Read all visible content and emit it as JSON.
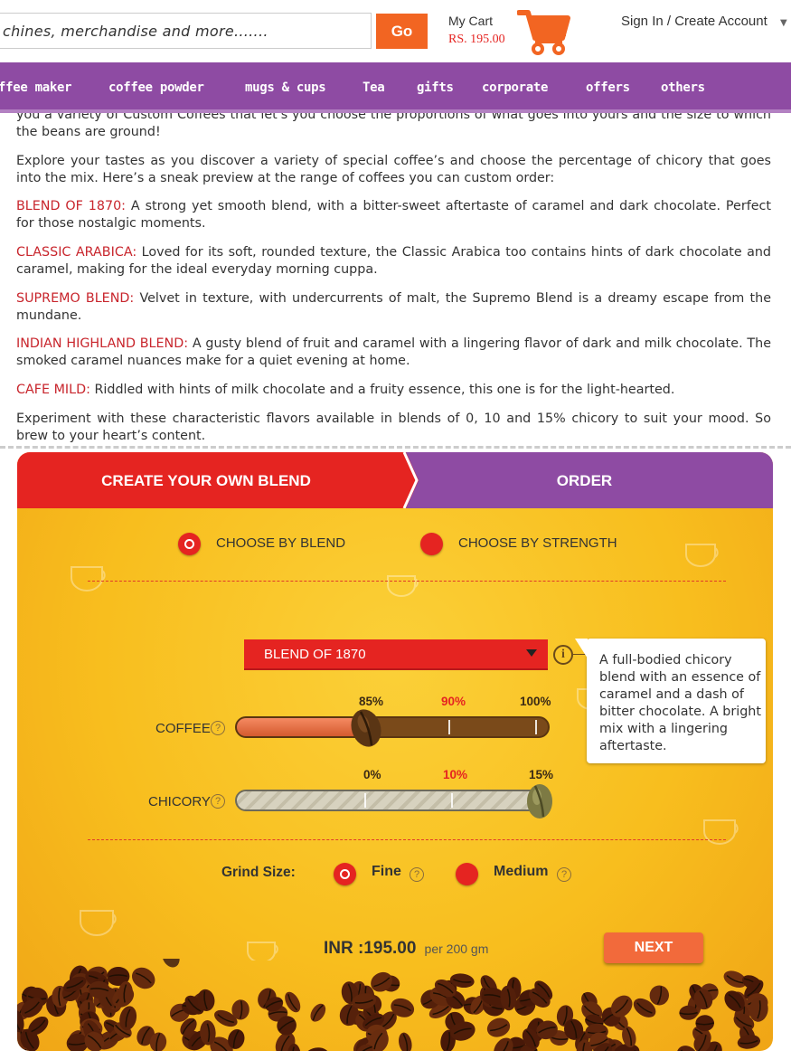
{
  "header": {
    "search_placeholder": "chines, merchandise and more.......",
    "search_button": "Go",
    "cart_title": "My Cart",
    "cart_amount": "RS. 195.00",
    "account_link": "Sign In / Create Account"
  },
  "nav": {
    "items": [
      "ffee maker",
      "coffee powder",
      "mugs & cups",
      "Tea",
      "gifts",
      "corporate",
      "offers",
      "others"
    ]
  },
  "article": {
    "intro_partial": "you a variety of Custom Coffees that let's you choose the proportions of what goes into yours and the size to which the beans are ground!",
    "explore": "Explore your tastes as you discover a variety of special coffee’s and choose the percentage of chicory that goes into the mix. Here’s a sneak preview at the range of coffees you can custom order:",
    "blends": [
      {
        "name": "BLEND OF 1870:",
        "desc": " A strong yet smooth blend, with a bitter-sweet aftertaste of caramel and dark chocolate. Perfect for those nostalgic moments."
      },
      {
        "name": "CLASSIC ARABICA:",
        "desc": " Loved for its soft, rounded texture, the Classic Arabica too contains hints of dark chocolate and caramel, making for the ideal everyday morning cuppa."
      },
      {
        "name": "SUPREMO BLEND:",
        "desc": " Velvet in texture, with undercurrents of malt, the Supremo Blend is a dreamy escape from the mundane."
      },
      {
        "name": "INDIAN HIGHLAND BLEND:",
        "desc": " A gusty blend of fruit and caramel with a lingering flavor of dark and milk chocolate. The smoked caramel nuances make for a quiet evening at home."
      },
      {
        "name": "CAFE MILD:",
        "desc": " Riddled with hints of milk chocolate and a fruity essence, this one is for the light-hearted."
      }
    ],
    "closing": "Experiment with these characteristic flavors available in blends of 0, 10 and 15% chicory to suit your mood. So brew to your heart’s content."
  },
  "widget": {
    "tab_create": "CREATE YOUR OWN BLEND",
    "tab_order": "ORDER",
    "mode_blend": "CHOOSE BY BLEND",
    "mode_strength": "CHOOSE BY STRENGTH",
    "selected_mode": "blend",
    "blend_select": "BLEND OF 1870",
    "info_icon": "i",
    "tooltip": "A full-bodied chicory blend with an essence of caramel and a dash of bitter chocolate. A bright mix with a lingering aftertaste.",
    "coffee": {
      "label": "COFFEE",
      "ticks": [
        "85%",
        "90%",
        "100%"
      ],
      "value_percent": 85
    },
    "chicory": {
      "label": "CHICORY",
      "ticks": [
        "0%",
        "10%",
        "15%"
      ],
      "value_percent": 15
    },
    "help_icon": "?",
    "grind_label": "Grind Size:",
    "grind_options": [
      "Fine",
      "Medium"
    ],
    "selected_grind": "Fine",
    "price_value": "INR :195.00",
    "price_unit": "per 200 gm",
    "next_button": "NEXT"
  },
  "colors": {
    "brand_red": "#e52421",
    "nav_purple": "#8e4ba3",
    "button_orange": "#f26522",
    "widget_yellow": "#f8be1e"
  }
}
